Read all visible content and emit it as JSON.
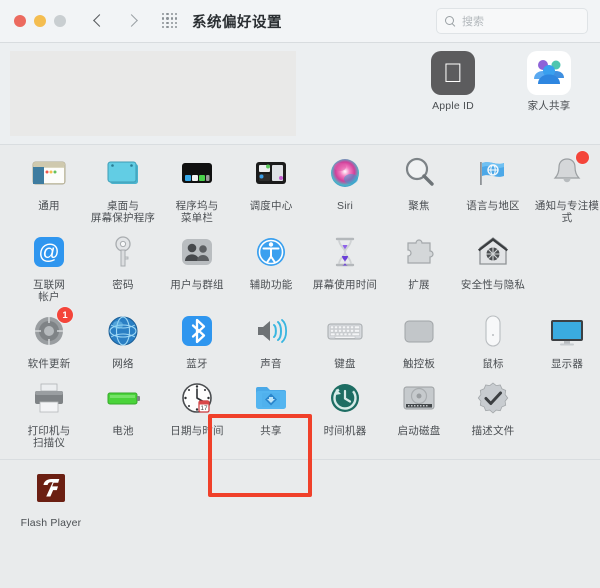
{
  "window": {
    "title": "系统偏好设置",
    "traffic_lights": [
      "close",
      "minimize",
      "zoom"
    ],
    "nav": {
      "back": "back-arrow",
      "forward": "forward-arrow"
    },
    "grid_button": "all-preferences-grid",
    "search": {
      "placeholder": "搜索",
      "value": "",
      "icon": "search-icon"
    }
  },
  "account_section": {
    "items": [
      {
        "label": "Apple ID",
        "icon": "apple-id-icon"
      },
      {
        "label": "家人共享",
        "icon": "family-sharing-icon"
      }
    ]
  },
  "main_grid": {
    "rows": [
      [
        {
          "label": "通用",
          "icon": "general-icon"
        },
        {
          "label": "桌面与\n屏幕保护程序",
          "icon": "desktop-screensaver-icon"
        },
        {
          "label": "程序坞与\n菜单栏",
          "icon": "dock-menubar-icon"
        },
        {
          "label": "调度中心",
          "icon": "mission-control-icon"
        },
        {
          "label": "Siri",
          "icon": "siri-icon"
        },
        {
          "label": "聚焦",
          "icon": "spotlight-icon"
        },
        {
          "label": "语言与地区",
          "icon": "language-region-icon"
        },
        {
          "label": "通知与专注模式",
          "icon": "notifications-focus-icon",
          "badge": ""
        }
      ],
      [
        {
          "label": "互联网\n帐户",
          "icon": "internet-accounts-icon"
        },
        {
          "label": "密码",
          "icon": "passwords-icon"
        },
        {
          "label": "用户与群组",
          "icon": "users-groups-icon"
        },
        {
          "label": "辅助功能",
          "icon": "accessibility-icon"
        },
        {
          "label": "屏幕使用时间",
          "icon": "screen-time-icon"
        },
        {
          "label": "扩展",
          "icon": "extensions-icon"
        },
        {
          "label": "安全性与隐私",
          "icon": "security-privacy-icon"
        }
      ],
      [
        {
          "label": "软件更新",
          "icon": "software-update-icon",
          "badge": "1"
        },
        {
          "label": "网络",
          "icon": "network-icon"
        },
        {
          "label": "蓝牙",
          "icon": "bluetooth-icon"
        },
        {
          "label": "声音",
          "icon": "sound-icon"
        },
        {
          "label": "键盘",
          "icon": "keyboard-icon"
        },
        {
          "label": "触控板",
          "icon": "trackpad-icon"
        },
        {
          "label": "鼠标",
          "icon": "mouse-icon"
        },
        {
          "label": "显示器",
          "icon": "displays-icon"
        }
      ],
      [
        {
          "label": "打印机与\n扫描仪",
          "icon": "printers-scanners-icon"
        },
        {
          "label": "电池",
          "icon": "battery-icon"
        },
        {
          "label": "日期与时间",
          "icon": "date-time-icon"
        },
        {
          "label": "共享",
          "icon": "sharing-icon",
          "highlighted": true
        },
        {
          "label": "时间机器",
          "icon": "time-machine-icon"
        },
        {
          "label": "启动磁盘",
          "icon": "startup-disk-icon"
        },
        {
          "label": "描述文件",
          "icon": "profiles-icon"
        }
      ]
    ]
  },
  "third_party_section": {
    "items": [
      {
        "label": "Flash Player",
        "icon": "flash-player-icon"
      }
    ]
  },
  "annotation": {
    "highlight_color": "#f0402a",
    "target_label": "共享"
  }
}
